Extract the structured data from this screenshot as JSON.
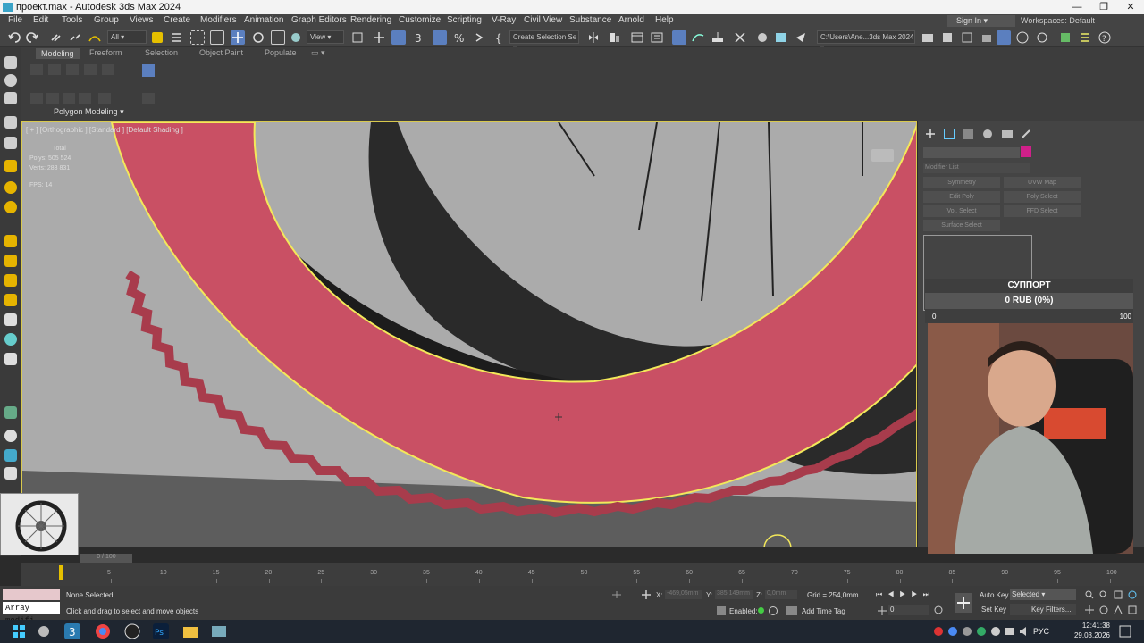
{
  "window": {
    "title": "проект.max - Autodesk 3ds Max 2024",
    "controls": [
      "—",
      "❐",
      "✕"
    ]
  },
  "menu": {
    "items": [
      "File",
      "Edit",
      "Tools",
      "Group",
      "Views",
      "Create",
      "Modifiers",
      "Animation",
      "Graph Editors",
      "Rendering",
      "Customize",
      "Scripting",
      "V-Ray",
      "Civil View",
      "Substance",
      "Arnold",
      "Help"
    ],
    "sign_in": "Sign In",
    "workspace_label": "Workspaces:",
    "workspace_value": "Default"
  },
  "toolbar": {
    "filter_select": "All",
    "view_select": "View",
    "selection_set": "Create Selection Se",
    "path": "C:\\Users\\Ane...3ds Max 2024"
  },
  "ribbon": {
    "tabs": [
      "Modeling",
      "Freeform",
      "Selection",
      "Object Paint",
      "Populate"
    ],
    "active_tab": "Modeling",
    "panel_label": "Polygon Modeling"
  },
  "viewport": {
    "label": "[ + ] [Orthographic ] [Standard ] [Default Shading ]",
    "stats_total": "Total",
    "stats_polys": "Polys:  505 524",
    "stats_verts": "Verts:  283 831",
    "fps": "FPS:     14",
    "accent_color": "#c85060",
    "selection_color": "#f3e85a"
  },
  "command_panel": {
    "modifier_list": "Modifier List",
    "modifiers": [
      "Symmetry",
      "UVW Map",
      "Edit Poly",
      "Poly Select",
      "Vol. Select",
      "FFD Select",
      "Surface Select"
    ],
    "color_swatch": "#d0208a"
  },
  "support": {
    "title": "СУППОРТ",
    "amount": "0 RUB (0%)",
    "min": "0",
    "max": "100"
  },
  "timeline": {
    "frame_display": "0 / 100",
    "ticks": [
      "5",
      "10",
      "15",
      "20",
      "25",
      "30",
      "35",
      "40",
      "45",
      "50",
      "55",
      "60",
      "65",
      "70",
      "75",
      "80",
      "85",
      "90",
      "95",
      "100"
    ]
  },
  "status": {
    "modifier_field": "Array modifi",
    "selection": "None Selected",
    "prompt": "Click and drag to select and move objects",
    "x_label": "X:",
    "x_value": "-469,05mm",
    "y_label": "Y:",
    "y_value": "385,149mm",
    "z_label": "Z:",
    "z_value": "0,0mm",
    "grid": "Grid = 254,0mm",
    "enabled": "Enabled:",
    "add_time_tag": "Add Time Tag",
    "auto_key": "Auto Key",
    "set_key": "Set Key",
    "key_mode": "Selected",
    "key_filters": "Key Filters...",
    "frame": "0"
  },
  "taskbar": {
    "time": "12:41:38",
    "date": "29.03.2026",
    "lang": "РУС"
  }
}
